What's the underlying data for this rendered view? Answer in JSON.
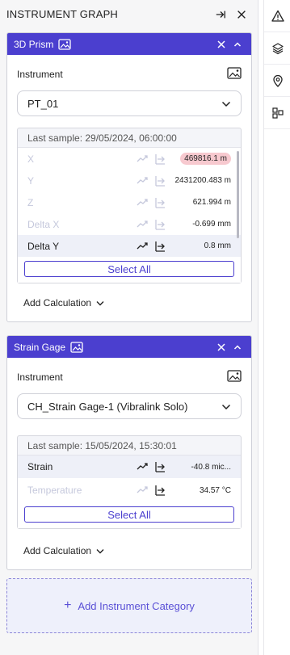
{
  "panel": {
    "title": "INSTRUMENT GRAPH"
  },
  "cards": [
    {
      "name": "3D Prism",
      "instrument_label": "Instrument",
      "instrument_value": "PT_01",
      "last_sample": "Last sample: 29/05/2024, 06:00:00",
      "rows": [
        {
          "name": "X",
          "value": "469816.1 m"
        },
        {
          "name": "Y",
          "value": "2431200.483 m"
        },
        {
          "name": "Z",
          "value": "621.994 m"
        },
        {
          "name": "Delta X",
          "value": "-0.699 mm"
        },
        {
          "name": "Delta Y",
          "value": "0.8 mm"
        }
      ],
      "select_all": "Select All",
      "add_calc": "Add Calculation"
    },
    {
      "name": "Strain Gage",
      "instrument_label": "Instrument",
      "instrument_value": "CH_Strain Gage-1 (Vibralink Solo)",
      "last_sample": "Last sample: 15/05/2024, 15:30:01",
      "rows": [
        {
          "name": "Strain",
          "value": "-40.8 mic..."
        },
        {
          "name": "Temperature",
          "value": "34.57 °C"
        }
      ],
      "select_all": "Select All",
      "add_calc": "Add Calculation"
    }
  ],
  "add_category": "Add Instrument Category",
  "colors": {
    "accent": "#4b3fcf",
    "warn_pill": "#f7c9cf",
    "dim_text": "#c5c8dc"
  },
  "rail_icons": [
    "warning-icon",
    "layers-icon",
    "location-pin-icon",
    "widgets-icon"
  ]
}
